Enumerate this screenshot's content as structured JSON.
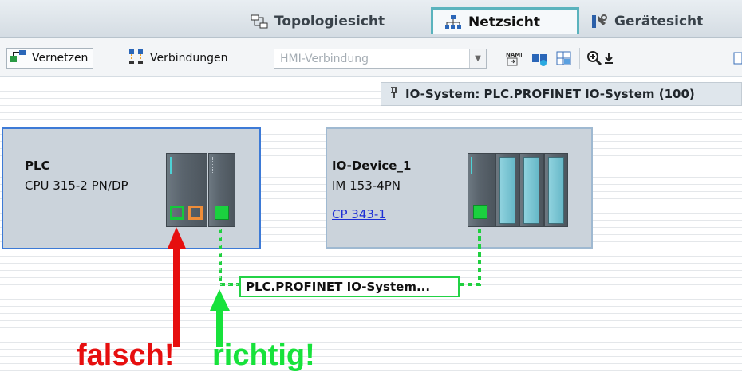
{
  "tabs": [
    {
      "label": "Topologiesicht",
      "icon": "topology-icon"
    },
    {
      "label": "Netzsicht",
      "icon": "network-icon",
      "active": true
    },
    {
      "label": "Gerätesicht",
      "icon": "device-icon"
    }
  ],
  "toolbar": {
    "network_label": "Vernetzen",
    "connections_label": "Verbindungen",
    "connection_type_value": "HMI-Verbindung"
  },
  "io_system": {
    "label": "IO-System: PLC.PROFINET IO-System (100)"
  },
  "plc": {
    "name": "PLC",
    "type": "CPU 315-2 PN/DP"
  },
  "io_device": {
    "name": "IO-Device_1",
    "type": "IM 153-4PN",
    "link": "CP 343-1"
  },
  "network_label": "PLC.PROFINET IO-System...",
  "annotations": {
    "wrong": "falsch!",
    "right": "richtig!"
  },
  "colors": {
    "wrong": "#e60f0f",
    "right": "#17e23b",
    "selection": "#3d7ad6",
    "tab_active_border": "#5ab3bd"
  }
}
